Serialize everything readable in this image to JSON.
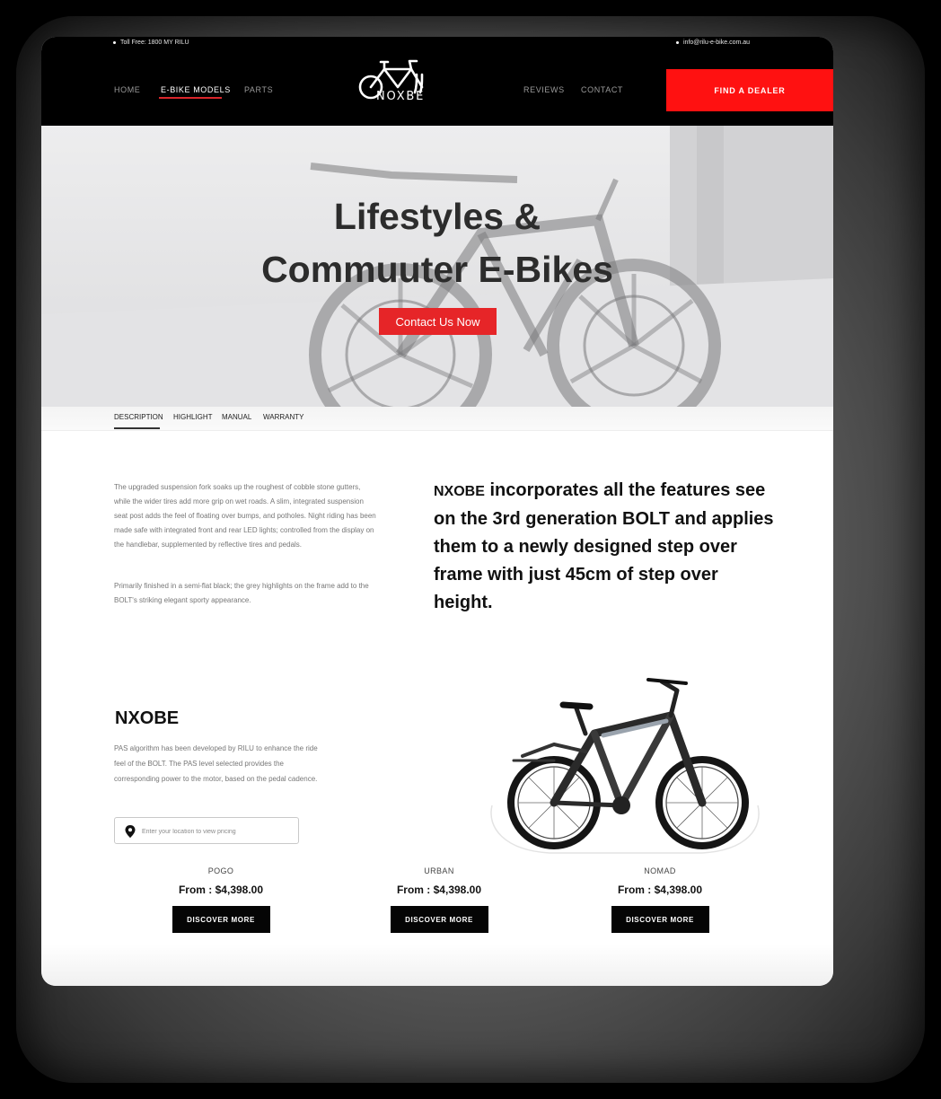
{
  "topbar": {
    "phone": "Toll Free: 1800 MY RILU",
    "email": "info@rilu-e-bike.com.au"
  },
  "nav": {
    "left": [
      "HOME",
      "E-BIKE MODELS",
      "PARTS"
    ],
    "right": [
      "REVIEWS",
      "CONTACT"
    ],
    "active": "E-BIKE MODELS",
    "cta": "FIND A DEALER"
  },
  "logo": {
    "text": "NOXBE"
  },
  "hero": {
    "title_line1": "Lifestyles &",
    "title_line2": "Commuuter E-Bikes",
    "cta": "Contact Us Now"
  },
  "tabs": [
    "DESCRIPTION",
    "HIGHLIGHT",
    "MANUAL",
    "WARRANTY"
  ],
  "description": {
    "paragraph1": "The upgraded suspension fork soaks up the roughest of cobble stone gutters, while the wider tires add more grip on wet roads. A slim, integrated suspension seat post adds the feel of floating over bumps, and potholes. Night riding has been made safe with integrated front and rear LED lights; controlled from the display on the handlebar, supplemented by reflective tires and pedals.",
    "paragraph2": "Primarily finished in a semi-flat black; the grey highlights on the frame add to the BOLT's striking elegant sporty appearance.",
    "feature_brand": "NXOBE",
    "feature_text": " incorporates all the features see on the 3rd generation BOLT and applies them to a newly designed step over frame with just 45cm of step over height."
  },
  "product": {
    "title": "NXOBE",
    "description": "PAS algorithm has been developed by RILU to enhance the ride feel of the BOLT. The PAS level selected provides the corresponding power to the motor, based on the pedal cadence.",
    "location_placeholder": "Enter your location to view pricing",
    "models": [
      {
        "name": "POGO",
        "price": "From : $4,398.00",
        "cta": "DISCOVER MORE"
      },
      {
        "name": "URBAN",
        "price": "From : $4,398.00",
        "cta": "DISCOVER MORE"
      },
      {
        "name": "NOMAD",
        "price": "From : $4,398.00",
        "cta": "DISCOVER MORE"
      }
    ]
  },
  "colors": {
    "accent": "#ff1111",
    "header": "#000000",
    "text": "#111111"
  }
}
